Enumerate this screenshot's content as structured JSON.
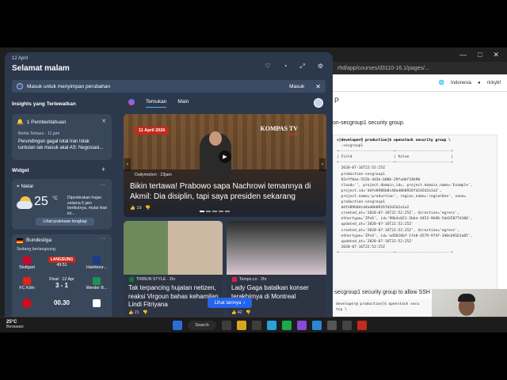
{
  "browser": {
    "url_fragment": "rhd/app/courses/d3110-16.1/pages/...",
    "language": "Indonesia",
    "user": "rickybf",
    "page_marker": "P",
    "line1": "on-secgroup1 security group.",
    "terminal_lines": [
      "+[developer@ production]$ openstack security group \\",
      "  -secgroup1",
      "+-------------------------+-------------------------+",
      "| Field                   | Value                   |",
      "+-------------------------+-------------------------+",
      "  2020-07-16T22:52:25Z",
      "  production-secgroup1",
      "  82eff0aa-552b-4d3b-b80b-29fadbf24b90",
      "  cloud='', project.domain_id=, project.domain_name='Example',",
      "  project.id='ddfe8986b8c40ad0b0926fd2d2d2a1a2',",
      "  project.name='production', region_name='regionOne', zone=",
      "  production-secgroup1",
      "  ddfe89b8dcd4ad0b0926fd2d2d2a1a2",
      "  created_at='2020-07-16T22:52:25Z', direction='egress',",
      "  ethertype='IPv6', id='99b4c021-2bbe-4453-9b96-5dd35877d100',",
      "  updated_at='2020-07-16T22:52:25Z'",
      "  created_at='2020-07-16T22:52:25Z', direction='egress',",
      "  ethertype='IPv4', id='ad5016bf-1fe0-4579-974f-340cb91b1a05',",
      "  updated_at='2020-07-16T22:52:25Z'",
      "",
      "  2020-07-16T22:52:25Z",
      "+-------------------------+-------------------------+"
    ],
    "line2": "-secgroup1 security group to allow SSH access.",
    "terminal2_lines": [
      "developer@ production]$ openstack secu",
      "tcp \\"
    ]
  },
  "panel": {
    "date": "12 April",
    "greeting": "Selamat malam",
    "signin_text": "Masuk untuk menyimpan perubahan",
    "signin_button": "Masuk",
    "insights_title": "Insights yang Terlewatkan",
    "notification": {
      "header": "1 Pemberitahuan",
      "source": "Berita Terbaru · 11 jam",
      "body": "Perundingan gagal total Iran tolak tuntutan tak masuk akal AS: Negosiasi..."
    },
    "widget_title": "Widget",
    "weather": {
      "location": "Natar",
      "temp": "25",
      "unit": "°C",
      "desc": "Diperkirakan hujan selama 5 jam berikutnya, mulai Hari ini...",
      "button": "Lihat prakiraan lengkap"
    },
    "sports": {
      "league": "Bundesliga",
      "subtitle": "Sedang berlangsung",
      "matches": [
        {
          "home": "Stuttgart",
          "status": "LANGSUNG",
          "time": "49:51",
          "away": "Hambour..."
        },
        {
          "home": "FC Köln",
          "status": "Final · 12 Apr",
          "score": "3 - 1",
          "away": "Werder B..."
        },
        {
          "home": "",
          "status": "",
          "score": "00.30",
          "away": ""
        }
      ]
    },
    "tabs": [
      "Temukan",
      "Main"
    ],
    "hero": {
      "badge": "11 April 2026",
      "channel": "KOMPAS TV",
      "channel_live": "LIVE",
      "source": "Dailymotion · 23jam",
      "title": "Bikin tertawa! Prabowo sapa Nachrowi temannya di Akmil: Dia disiplin, tapi saya presiden sekarang",
      "likes": "19"
    },
    "news": [
      {
        "source": "TRIBUN STYLE · 2hr",
        "title": "Tak terpancing hujatan netizen, reaksi Virgoun bahas kehamilan Lindi Fitriyana",
        "likes": "21"
      },
      {
        "source": "Tempo.co · 2hr",
        "title": "Lady Gaga batalkan konser terakhirnya di Montreal",
        "likes": "42"
      }
    ],
    "see_more": "Lihat lainnya"
  },
  "taskbar": {
    "temp": "25°C",
    "condition": "Berawan",
    "search": "Search"
  },
  "colors": {
    "panel_bg": "#2c3a4e",
    "accent": "#2563eb",
    "live_red": "#c42b1c"
  }
}
